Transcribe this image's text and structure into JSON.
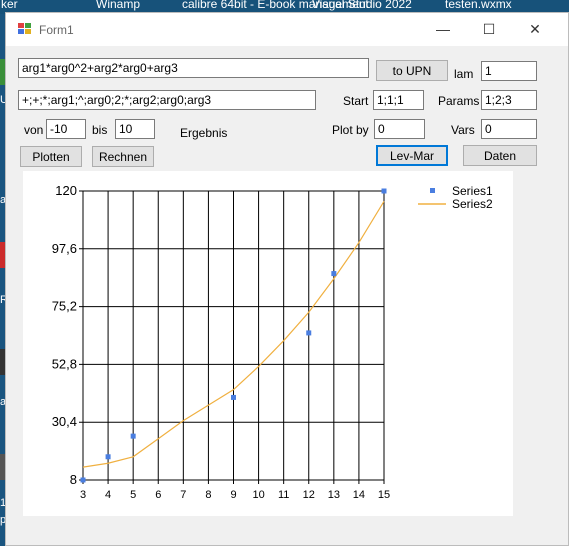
{
  "desktop": {
    "top_labels": [
      "ker",
      "Winamp",
      "calibre 64bit - E-book management",
      "Visual Studio 2022",
      "testen.wxmx"
    ],
    "side_labels": [
      "U",
      "a",
      "R",
      "ar",
      "10",
      "pt"
    ]
  },
  "window": {
    "title": "Form1",
    "controls": {
      "minimize": "—",
      "maximize": "☐",
      "close": "✕"
    }
  },
  "form": {
    "formula_value": "arg1*arg0^2+arg2*arg0+arg3",
    "upn_value": "+;+;*;arg1;^;arg0;2;*;arg2;arg0;arg3",
    "to_upn_label": "to UPN",
    "lam_label": "lam",
    "lam_value": "1",
    "start_label": "Start",
    "start_value": "1;1;1",
    "params_label": "Params",
    "params_value": "1;2;3",
    "von_label": "von",
    "von_value": "-10",
    "bis_label": "bis",
    "bis_value": "10",
    "ergebnis_label": "Ergebnis",
    "plotby_label": "Plot by",
    "plotby_value": "0",
    "vars_label": "Vars",
    "vars_value": "0",
    "plotten_label": "Plotten",
    "rechnen_label": "Rechnen",
    "levmar_label": "Lev-Mar",
    "daten_label": "Daten"
  },
  "chart_data": {
    "type": "scatter",
    "xlim": [
      3,
      15
    ],
    "ylim": [
      8,
      120
    ],
    "xticks": [
      "3",
      "4",
      "5",
      "6",
      "7",
      "8",
      "9",
      "10",
      "11",
      "12",
      "13",
      "14",
      "15"
    ],
    "yticks": [
      "8",
      "30,4",
      "52,8",
      "75,2",
      "97,6",
      "120"
    ],
    "grid": true,
    "legend_position": "top-right",
    "series": [
      {
        "name": "Series1",
        "kind": "points",
        "color": "#4a7ee0",
        "x": [
          3,
          4,
          5,
          9,
          12,
          13,
          15
        ],
        "y": [
          8,
          17,
          25,
          40,
          65,
          88,
          120
        ]
      },
      {
        "name": "Series2",
        "kind": "line",
        "color": "#f0b040",
        "x": [
          3,
          4,
          5,
          6,
          7,
          8,
          9,
          10,
          11,
          12,
          13,
          14,
          15
        ],
        "y": [
          13,
          14.5,
          17,
          24,
          31,
          37,
          43,
          52,
          62,
          73,
          86,
          100,
          116
        ]
      }
    ]
  }
}
